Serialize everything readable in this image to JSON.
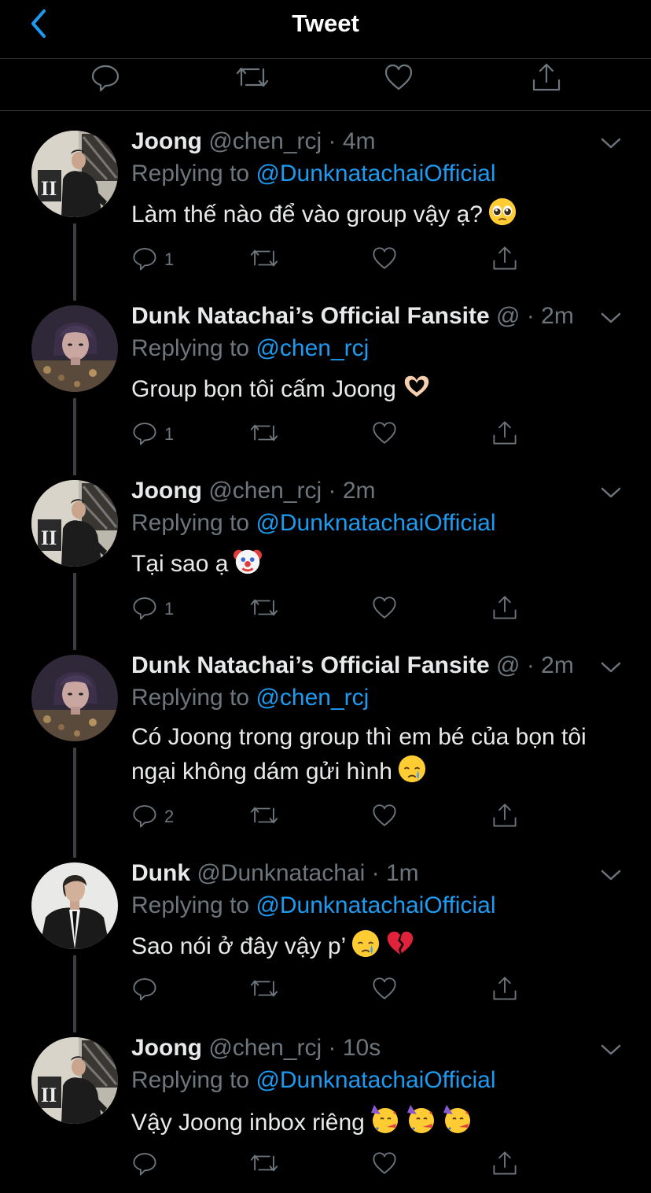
{
  "header": {
    "title": "Tweet"
  },
  "tweets": [
    {
      "name": "Joong",
      "handle": "@chen_rcj",
      "time": "4m",
      "replying_prefix": "Replying to",
      "replying_to": "@DunknatachaiOfficial",
      "text": "Làm thế nào để vào group vậy ạ?",
      "reply_count": "1",
      "emoji": [
        "pleading-face"
      ]
    },
    {
      "name": "Dunk Natachai’s Official Fansite",
      "handle": "@",
      "time": "2m",
      "replying_prefix": "Replying to",
      "replying_to": "@chen_rcj",
      "text": "Group bọn tôi cấm Joong",
      "reply_count": "1",
      "emoji": [
        "heart-hands"
      ]
    },
    {
      "name": "Joong",
      "handle": "@chen_rcj",
      "time": "2m",
      "replying_prefix": "Replying to",
      "replying_to": "@DunknatachaiOfficial",
      "text": "Tại sao ạ",
      "reply_count": "1",
      "emoji": [
        "clown-face"
      ]
    },
    {
      "name": "Dunk Natachai’s Official Fansite",
      "handle": "@",
      "time": "2m",
      "replying_prefix": "Replying to",
      "replying_to": "@chen_rcj",
      "text": "Có Joong trong group thì em bé của bọn tôi ngại không dám gửi hình",
      "reply_count": "2",
      "emoji": [
        "crying-face"
      ]
    },
    {
      "name": "Dunk",
      "handle": "@Dunknatachai",
      "time": "1m",
      "replying_prefix": "Replying to",
      "replying_to": "@DunknatachaiOfficial",
      "text": "Sao nói ở đây vậy p’",
      "reply_count": "",
      "emoji": [
        "crying-face",
        "broken-heart"
      ]
    },
    {
      "name": "Joong",
      "handle": "@chen_rcj",
      "time": "10s",
      "replying_prefix": "Replying to",
      "replying_to": "@DunknatachaiOfficial",
      "text": "Vậy Joong inbox riêng",
      "reply_count": "",
      "emoji": [
        "partying-face",
        "partying-face",
        "partying-face"
      ]
    }
  ],
  "colors": {
    "background": "#000000",
    "link": "#1d9bf0",
    "muted": "#6e767d",
    "text": "#e7e9ea",
    "divider": "#2f3336"
  }
}
